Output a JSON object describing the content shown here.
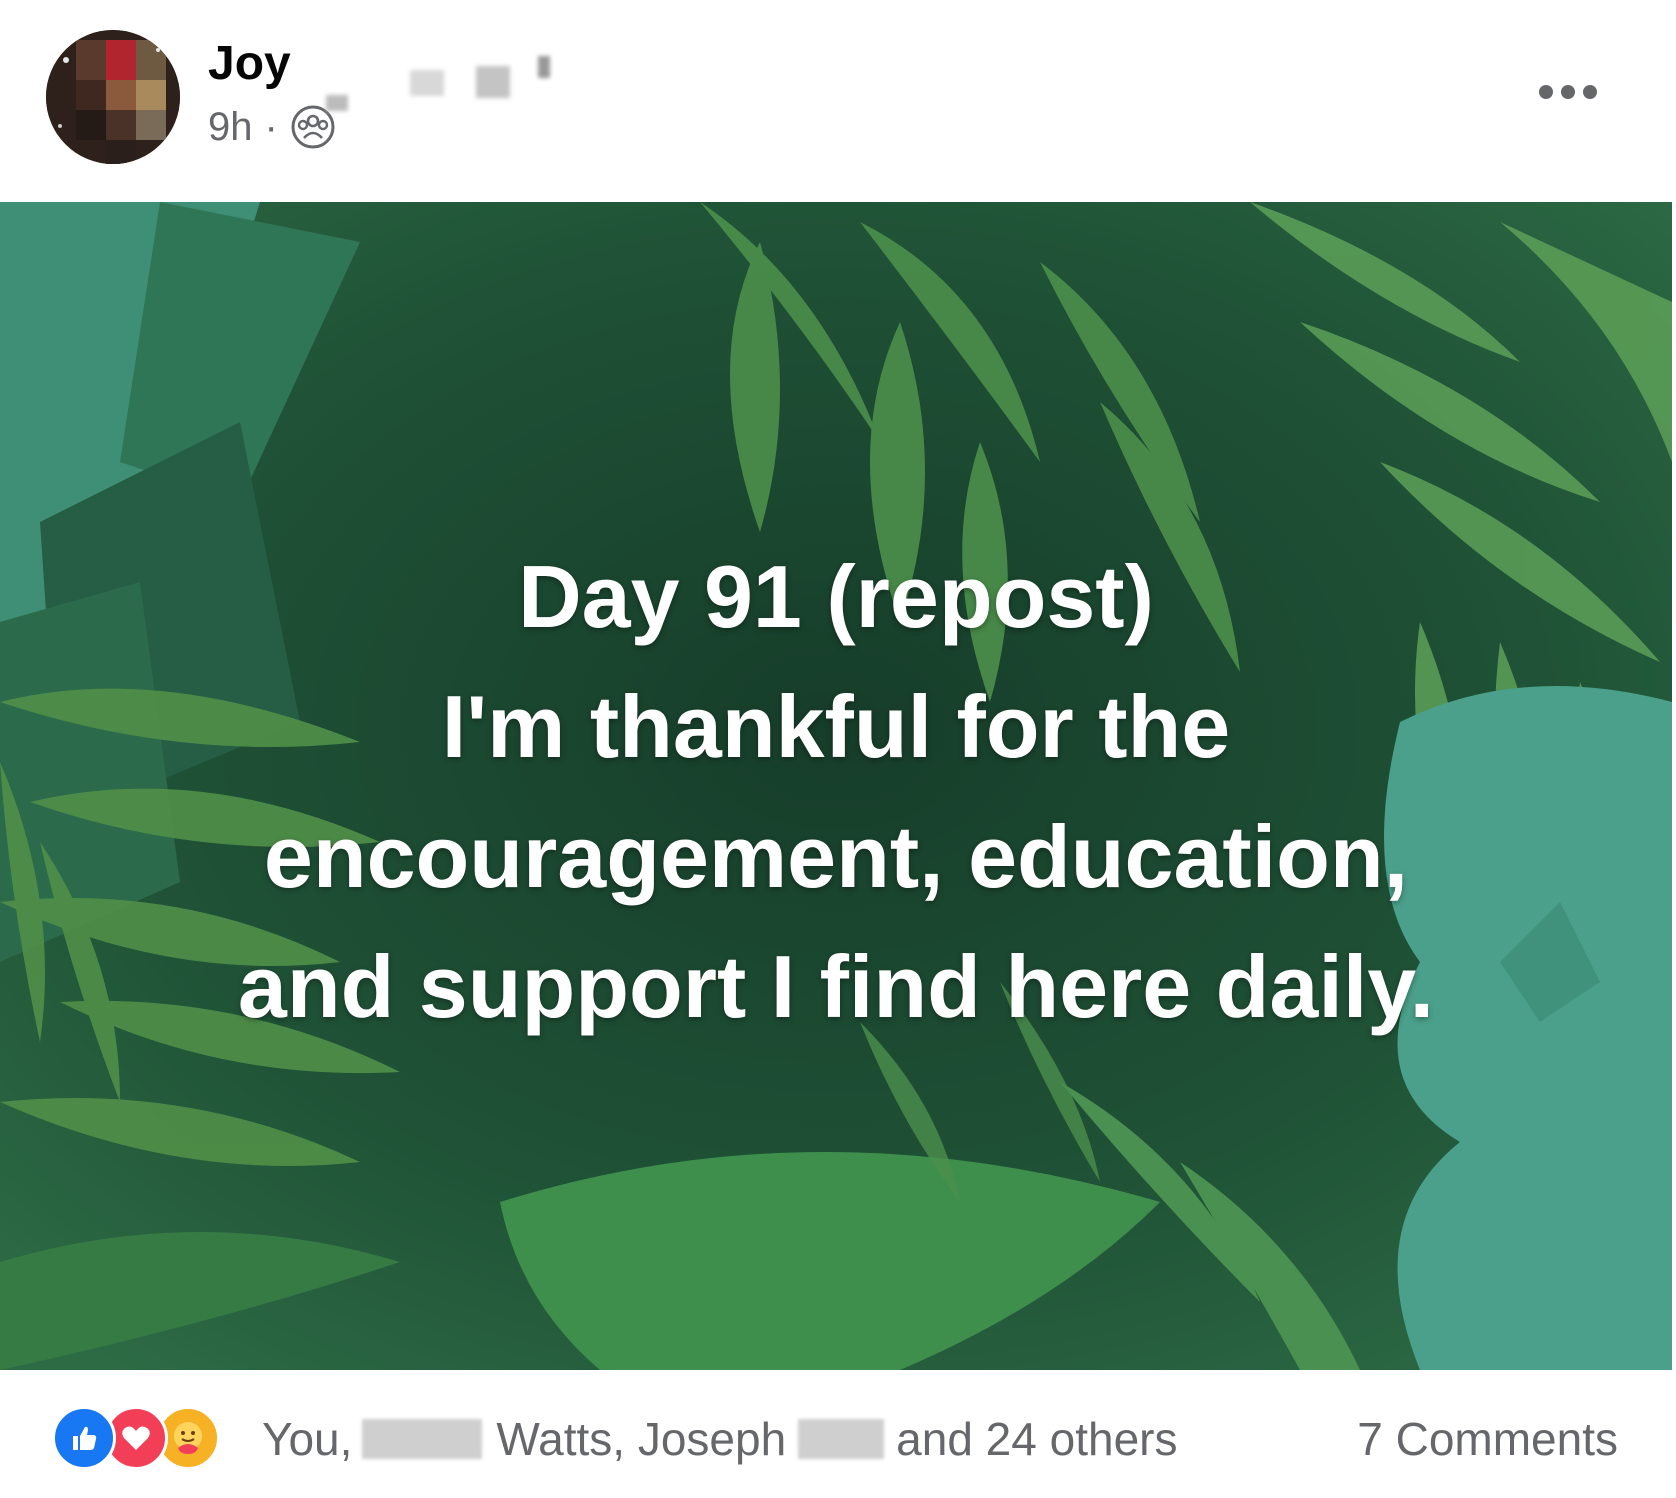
{
  "post": {
    "author": "Joy",
    "time": "9h",
    "separator": "·",
    "audience_icon": "group-icon",
    "more_icon": "more-options-icon",
    "image_text": {
      "line1": "Day 91 (repost)",
      "line2": "I'm thankful for the",
      "line3": "encouragement, education,",
      "line4": "and support I find here daily."
    }
  },
  "footer": {
    "reaction_icons": [
      "like-icon",
      "love-icon",
      "care-icon"
    ],
    "reactors_prefix": "You,",
    "reactors_middle": "Watts, Joseph",
    "reactors_suffix": "and 24 others",
    "comments": "7 Comments"
  },
  "colors": {
    "like": "#1877f2",
    "love": "#f33e58",
    "care": "#f7b125",
    "secondary_text": "#65676b",
    "primary_text": "#050505"
  }
}
